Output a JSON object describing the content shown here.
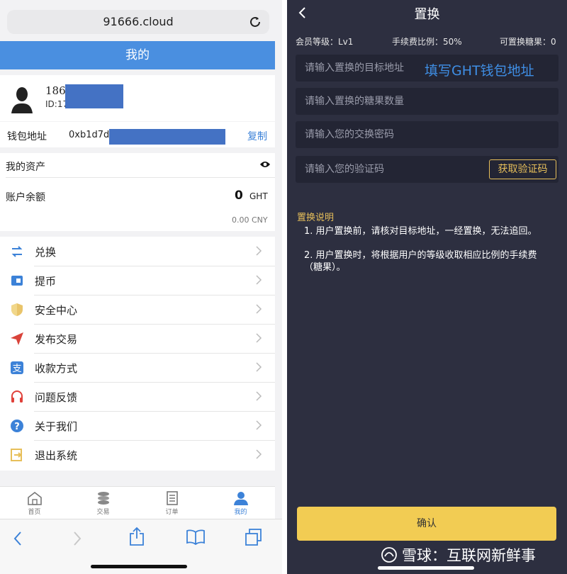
{
  "left": {
    "browser": {
      "url": "91666.cloud"
    },
    "header": {
      "title": "我的"
    },
    "user": {
      "phone": "186",
      "id_prefix": "ID:17"
    },
    "wallet": {
      "label": "钱包地址",
      "address": "0xb1d7d6",
      "copy_label": "复制"
    },
    "assets": {
      "title": "我的资产"
    },
    "balance": {
      "label": "账户余额",
      "amount": "0",
      "unit": "GHT",
      "cny": "0.00 CNY"
    },
    "menu": [
      {
        "label": "兑换",
        "icon": "exchange-arrows-icon"
      },
      {
        "label": "提币",
        "icon": "wallet-icon"
      },
      {
        "label": "安全中心",
        "icon": "shield-icon"
      },
      {
        "label": "发布交易",
        "icon": "paper-plane-icon"
      },
      {
        "label": "收款方式",
        "icon": "alipay-icon"
      },
      {
        "label": "问题反馈",
        "icon": "headphones-icon"
      },
      {
        "label": "关于我们",
        "icon": "question-circle-icon"
      },
      {
        "label": "退出系统",
        "icon": "logout-icon"
      }
    ],
    "tabs": [
      {
        "label": "首页",
        "icon": "home-icon"
      },
      {
        "label": "交易",
        "icon": "coins-icon"
      },
      {
        "label": "订单",
        "icon": "order-icon"
      },
      {
        "label": "我的",
        "icon": "user-icon",
        "active": true
      }
    ],
    "colors": {
      "accent": "#4a8fe0",
      "link": "#3c82d8"
    }
  },
  "right": {
    "header": {
      "title": "置换"
    },
    "stats": {
      "level": "会员等级：Lv1",
      "fee": "手续费比例：50%",
      "candy": "可置换糖果：0"
    },
    "fields": {
      "target_placeholder": "请输入置换的目标地址",
      "amount_placeholder": "请输入置换的糖果数量",
      "password_placeholder": "请输入您的交换密码",
      "code_placeholder": "请输入您的验证码"
    },
    "annotation": "填写GHT钱包地址",
    "code_button": "获取验证码",
    "notes": {
      "title": "置换说明",
      "items": [
        "1. 用户置换前，请核对目标地址，一经置换，无法追回。",
        "2. 用户置换时，将根据用户的等级收取相应比例的手续费（糖果）。"
      ]
    },
    "confirm": "确认",
    "watermark": "雪球：互联网新鲜事",
    "colors": {
      "background": "#2d2f40",
      "gold": "#e7bf5a",
      "button": "#f2cc53"
    }
  }
}
